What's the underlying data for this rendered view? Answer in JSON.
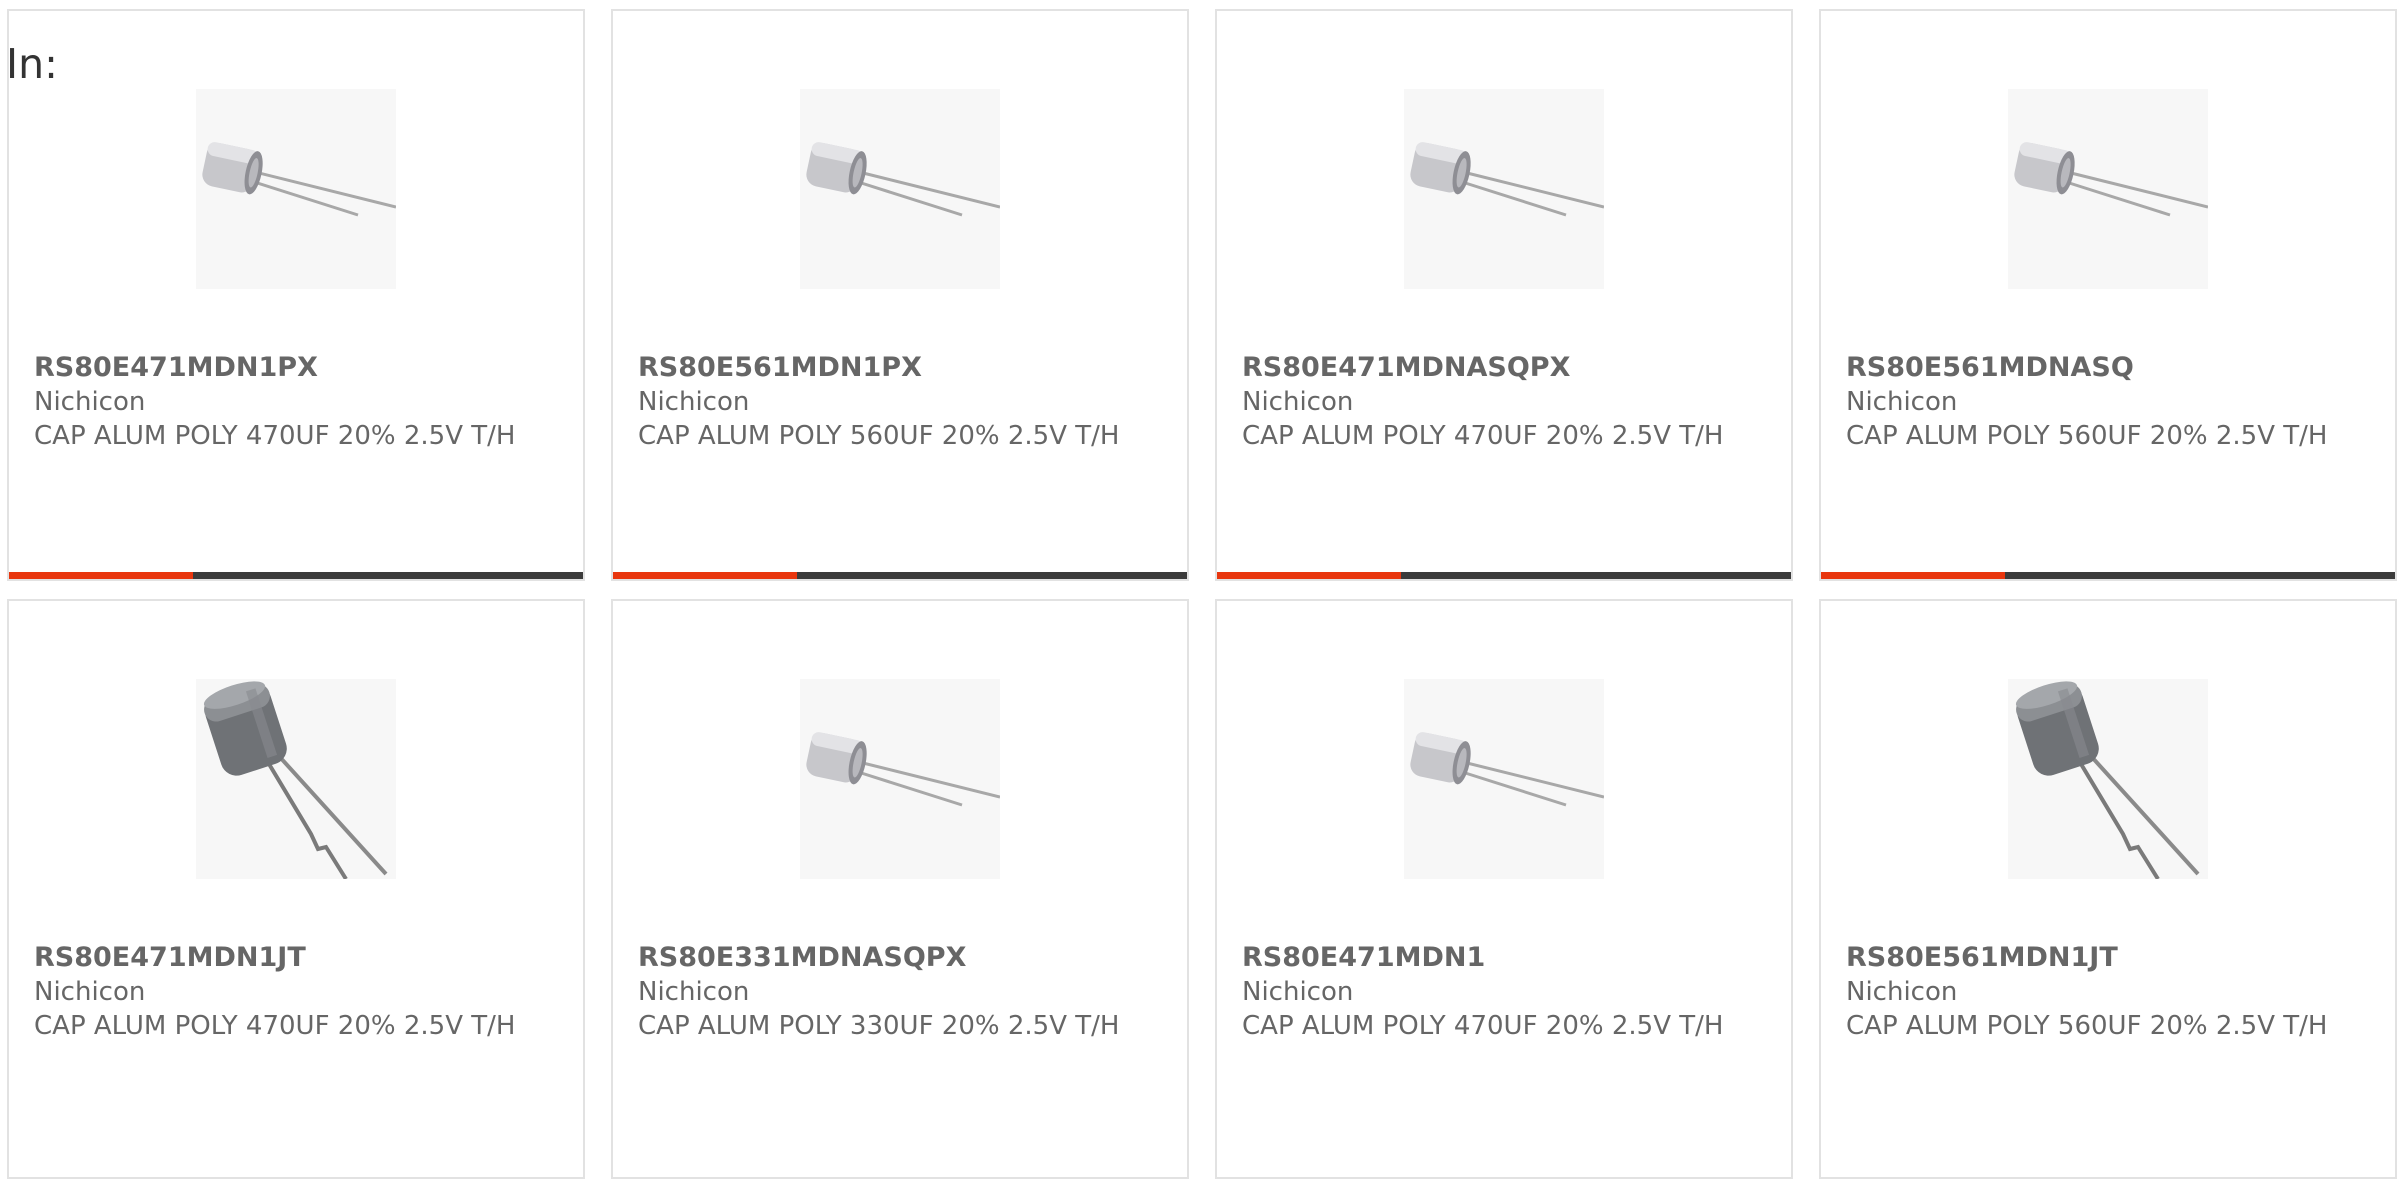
{
  "header": {
    "prefix_label": "In:"
  },
  "theme": {
    "accent": "#e8360e",
    "bar_dark": "#3b3b3b",
    "border": "#e2e2e2",
    "text": "#666666"
  },
  "products": [
    {
      "part": "RS80E471MDN1PX",
      "manufacturer": "Nichicon",
      "description": "CAP ALUM POLY 470UF 20% 2.5V T/H",
      "image_icon": "capacitor-radial-icon",
      "accent_fill": 0.32
    },
    {
      "part": "RS80E561MDN1PX",
      "manufacturer": "Nichicon",
      "description": "CAP ALUM POLY 560UF 20% 2.5V T/H",
      "image_icon": "capacitor-radial-icon",
      "accent_fill": 0.32
    },
    {
      "part": "RS80E471MDNASQPX",
      "manufacturer": "Nichicon",
      "description": "CAP ALUM POLY 470UF 20% 2.5V T/H",
      "image_icon": "capacitor-radial-icon",
      "accent_fill": 0.32
    },
    {
      "part": "RS80E561MDNASQ",
      "manufacturer": "Nichicon",
      "description": "CAP ALUM POLY 560UF 20% 2.5V T/H",
      "image_icon": "capacitor-radial-icon",
      "accent_fill": 0.32
    },
    {
      "part": "RS80E471MDN1JT",
      "manufacturer": "Nichicon",
      "description": "CAP ALUM POLY 470UF 20% 2.5V T/H",
      "image_icon": "capacitor-taped-icon"
    },
    {
      "part": "RS80E331MDNASQPX",
      "manufacturer": "Nichicon",
      "description": "CAP ALUM POLY 330UF 20% 2.5V T/H",
      "image_icon": "capacitor-radial-icon"
    },
    {
      "part": "RS80E471MDN1",
      "manufacturer": "Nichicon",
      "description": "CAP ALUM POLY 470UF 20% 2.5V T/H",
      "image_icon": "capacitor-radial-icon"
    },
    {
      "part": "RS80E561MDN1JT",
      "manufacturer": "Nichicon",
      "description": "CAP ALUM POLY 560UF 20% 2.5V T/H",
      "image_icon": "capacitor-taped-icon"
    }
  ]
}
